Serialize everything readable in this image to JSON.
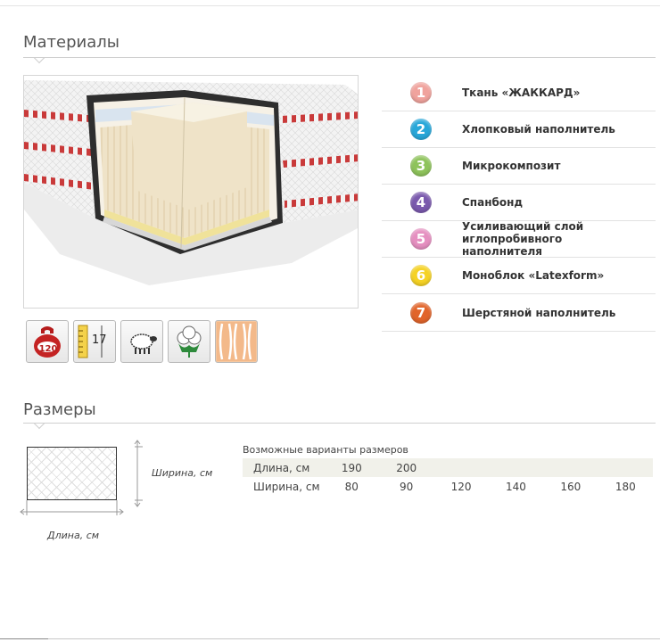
{
  "materials_section": {
    "title": "Материалы",
    "items": [
      {
        "number": "1",
        "label": "Ткань «ЖАККАРД»",
        "color": "#f0a39d"
      },
      {
        "number": "2",
        "label": "Хлопковый наполнитель",
        "color": "#27a7d9"
      },
      {
        "number": "3",
        "label": "Микрокомпозит",
        "color": "#8ec35b"
      },
      {
        "number": "4",
        "label": "Спанбонд",
        "color": "#7a59ad"
      },
      {
        "number": "5",
        "label": "Усиливающий слой иглопробивного наполнителя",
        "color": "#e58fc0"
      },
      {
        "number": "6",
        "label": "Моноблок «Latexform»",
        "color": "#f5d224"
      },
      {
        "number": "7",
        "label": "Шерстяной наполнитель",
        "color": "#e1642a"
      }
    ],
    "icons": [
      {
        "name": "weight-kettlebell-icon",
        "text": "120"
      },
      {
        "name": "height-ruler-icon",
        "text": "17"
      },
      {
        "name": "sheep-wool-icon"
      },
      {
        "name": "cotton-icon"
      },
      {
        "name": "latex-icon"
      }
    ]
  },
  "sizes_section": {
    "title": "Размеры",
    "width_label": "Ширина, см",
    "length_label": "Длина, см",
    "caption": "Возможные варианты размеров",
    "rows": [
      {
        "label": "Длина, см",
        "values": [
          "190",
          "200",
          "",
          "",
          "",
          ""
        ]
      },
      {
        "label": "Ширина, см",
        "values": [
          "80",
          "90",
          "120",
          "140",
          "160",
          "180"
        ]
      }
    ]
  }
}
